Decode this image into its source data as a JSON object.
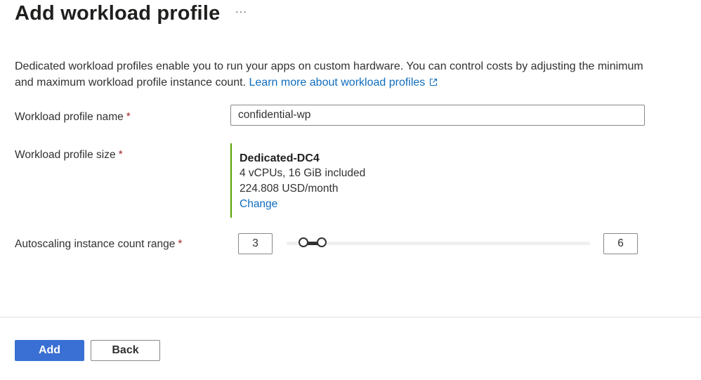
{
  "header": {
    "title": "Add workload profile",
    "more_label": "···"
  },
  "description": {
    "text": "Dedicated workload profiles enable you to run your apps on custom hardware. You can control costs by adjusting the minimum and maximum workload profile instance count.",
    "link_text": "Learn more about workload profiles",
    "link_icon": "external-link-icon"
  },
  "form": {
    "required_marker": "*",
    "name_label": "Workload profile name",
    "name_value": "confidential-wp",
    "size_label": "Workload profile size",
    "size": {
      "name": "Dedicated-DC4",
      "spec": "4 vCPUs, 16 GiB included",
      "price": "224.808 USD/month",
      "change_label": "Change",
      "accent_color": "#57a300"
    },
    "autoscale_label": "Autoscaling instance count range",
    "autoscale_min": "3",
    "autoscale_max": "6"
  },
  "footer": {
    "add_label": "Add",
    "back_label": "Back",
    "primary_color": "#3a6fd3"
  }
}
